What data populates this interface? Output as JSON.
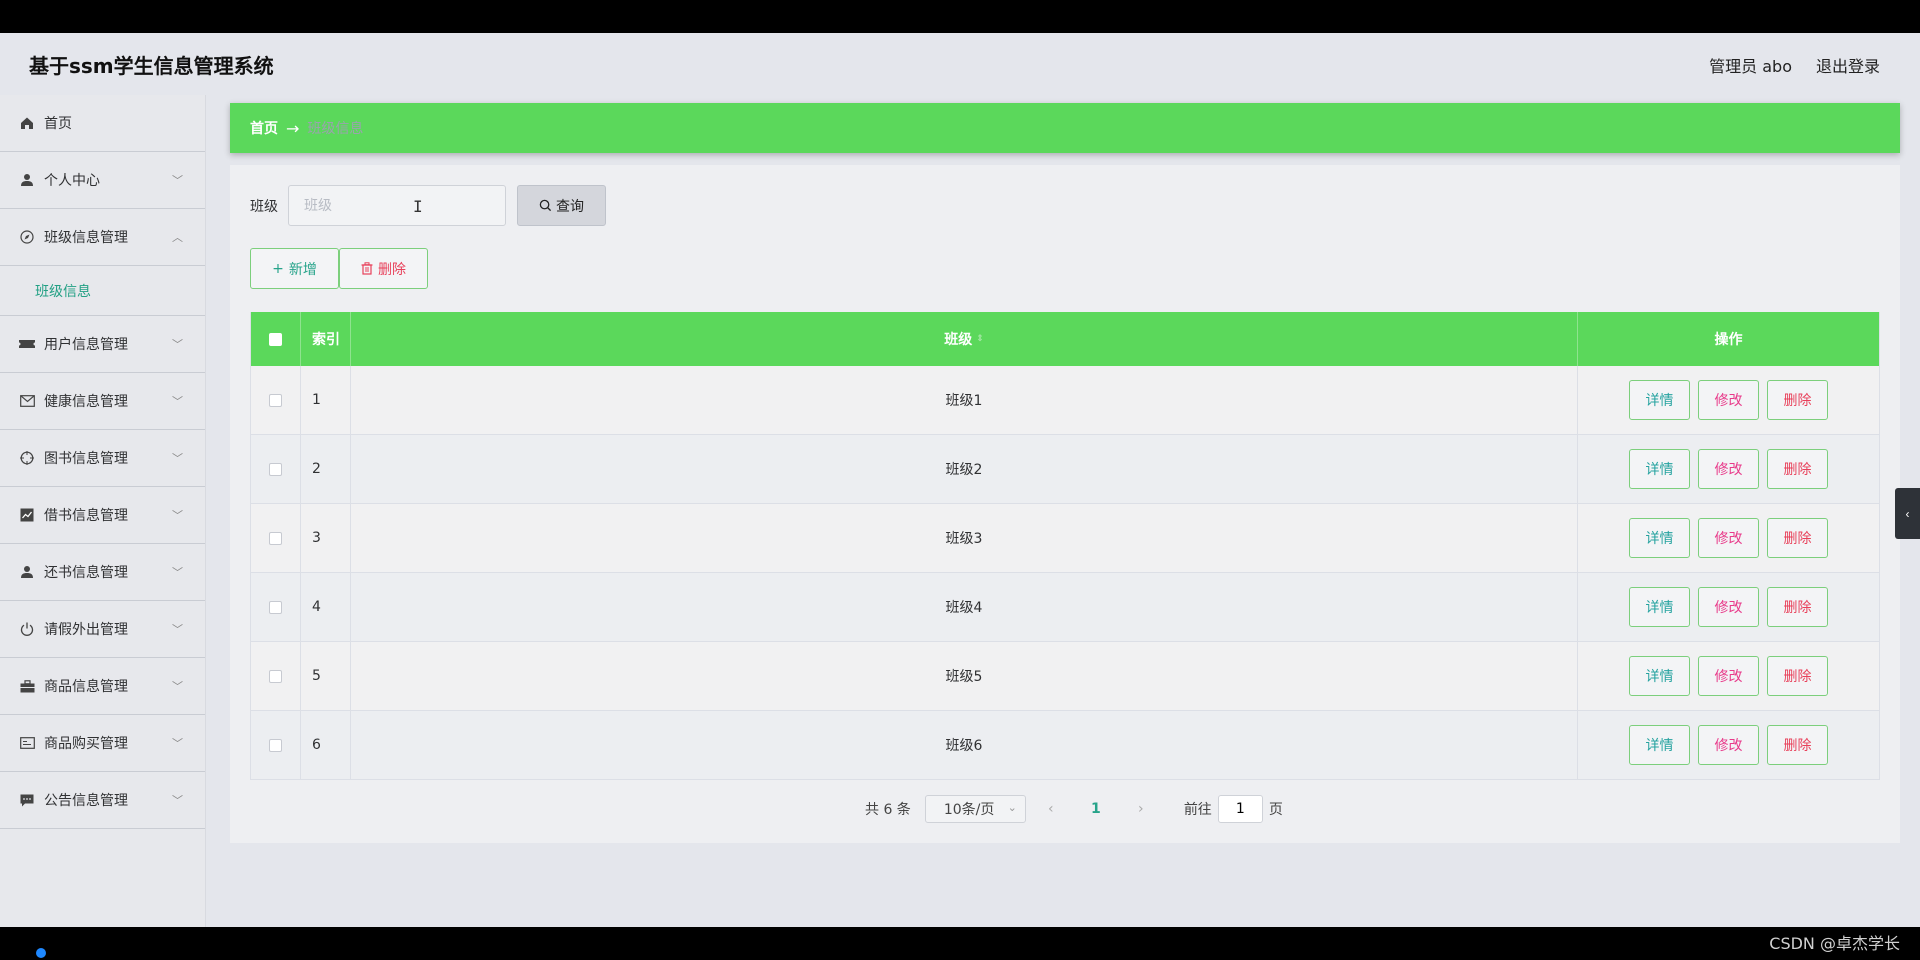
{
  "header": {
    "title": "基于ssm学生信息管理系统",
    "user": "管理员 abo",
    "logout": "退出登录"
  },
  "sidebar": {
    "items": [
      {
        "label": "首页",
        "icon": "home-icon",
        "expanded": false,
        "has_arrow": false
      },
      {
        "label": "个人中心",
        "icon": "user-icon",
        "expanded": false,
        "has_arrow": true
      },
      {
        "label": "班级信息管理",
        "icon": "compass-icon",
        "expanded": true,
        "has_arrow": true,
        "children": [
          "班级信息"
        ]
      },
      {
        "label": "用户信息管理",
        "icon": "ticket-icon",
        "expanded": false,
        "has_arrow": true
      },
      {
        "label": "健康信息管理",
        "icon": "mail-icon",
        "expanded": false,
        "has_arrow": true
      },
      {
        "label": "图书信息管理",
        "icon": "crosshair-icon",
        "expanded": false,
        "has_arrow": true
      },
      {
        "label": "借书信息管理",
        "icon": "chart-icon",
        "expanded": false,
        "has_arrow": true
      },
      {
        "label": "还书信息管理",
        "icon": "user-icon",
        "expanded": false,
        "has_arrow": true
      },
      {
        "label": "请假外出管理",
        "icon": "power-icon",
        "expanded": false,
        "has_arrow": true
      },
      {
        "label": "商品信息管理",
        "icon": "briefcase-icon",
        "expanded": false,
        "has_arrow": true
      },
      {
        "label": "商品购买管理",
        "icon": "card-icon",
        "expanded": false,
        "has_arrow": true
      },
      {
        "label": "公告信息管理",
        "icon": "chat-icon",
        "expanded": false,
        "has_arrow": true
      }
    ]
  },
  "breadcrumb": {
    "home": "首页",
    "separator": "→",
    "current": "班级信息"
  },
  "search": {
    "label": "班级",
    "placeholder": "班级",
    "value": "",
    "button": "查询"
  },
  "actions": {
    "add": "新增",
    "delete": "删除"
  },
  "table": {
    "columns": [
      "索引",
      "班级",
      "操作"
    ],
    "rows": [
      {
        "index": "1",
        "class": "班级1"
      },
      {
        "index": "2",
        "class": "班级2"
      },
      {
        "index": "3",
        "class": "班级3"
      },
      {
        "index": "4",
        "class": "班级4"
      },
      {
        "index": "5",
        "class": "班级5"
      },
      {
        "index": "6",
        "class": "班级6"
      }
    ],
    "row_ops": {
      "detail": "详情",
      "edit": "修改",
      "delete": "删除"
    }
  },
  "pagination": {
    "total": "共 6 条",
    "page_size": "10条/页",
    "current": "1",
    "goto_label": "前往",
    "goto_value": "1",
    "page_unit": "页"
  },
  "watermark": "CSDN @卓杰学长",
  "colors": {
    "accent_green": "#5bd85b",
    "link_teal": "#26a38a",
    "danger": "#e8405a",
    "edit_pink": "#e83a8a"
  }
}
